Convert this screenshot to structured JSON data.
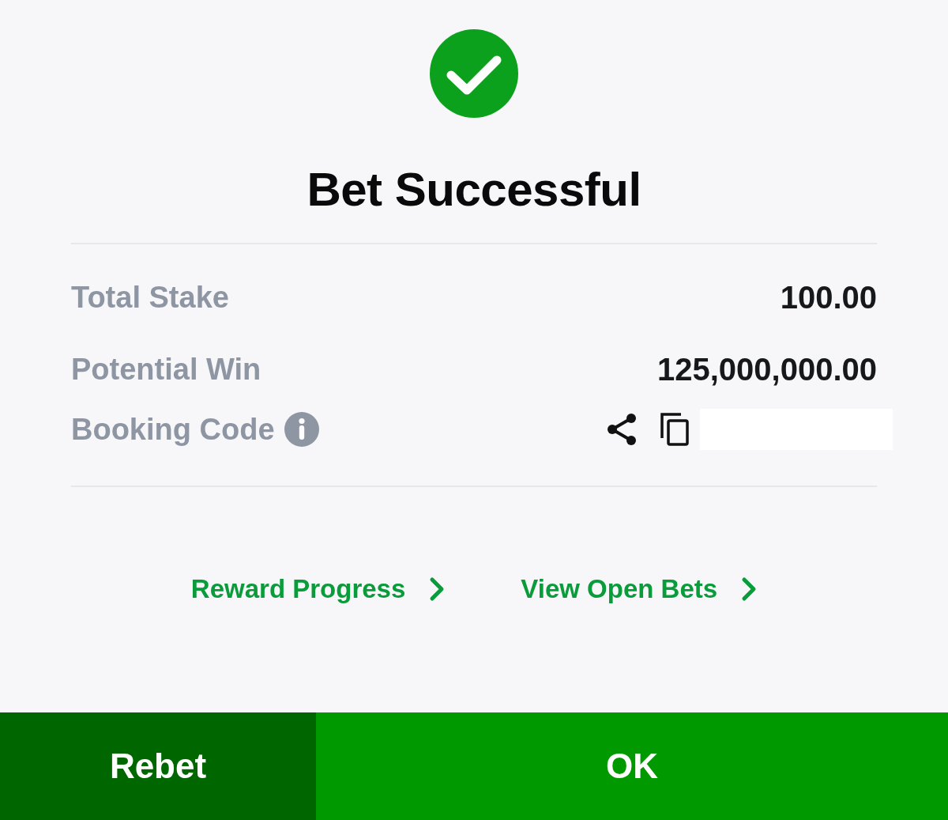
{
  "header": {
    "title": "Bet Successful"
  },
  "summary": [
    {
      "label": "Total Stake",
      "value": "100.00"
    },
    {
      "label": "Potential Win",
      "value": "125,000,000.00"
    }
  ],
  "booking_code": {
    "label": "Booking Code"
  },
  "links": [
    {
      "label": "Reward Progress"
    },
    {
      "label": "View Open Bets"
    }
  ],
  "buttons": [
    {
      "label": "Rebet",
      "kind": "secondary"
    },
    {
      "label": "OK",
      "kind": "primary"
    }
  ]
}
